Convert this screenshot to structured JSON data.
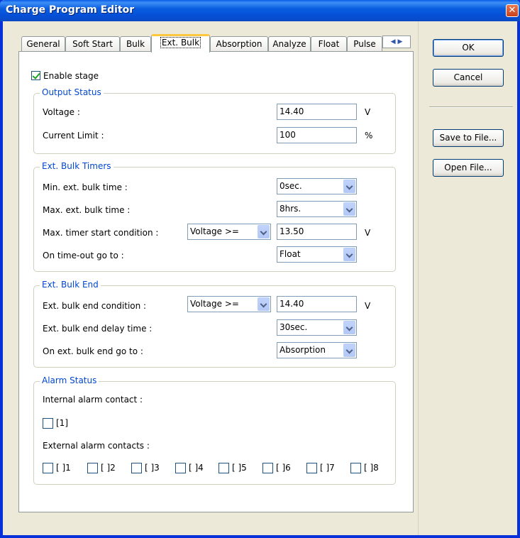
{
  "window": {
    "title": "Charge Program Editor",
    "close_icon": "close-icon"
  },
  "tabs": [
    {
      "label": "General"
    },
    {
      "label": "Soft Start"
    },
    {
      "label": "Bulk"
    },
    {
      "label": "Ext. Bulk",
      "active": true
    },
    {
      "label": "Absorption"
    },
    {
      "label": "Analyze"
    },
    {
      "label": "Float"
    },
    {
      "label": "Pulse"
    }
  ],
  "tab_scroll": {
    "left": "◀",
    "right": "▶"
  },
  "enable_stage": {
    "label": "Enable stage",
    "checked": true
  },
  "output_status": {
    "title": "Output Status",
    "voltage_label": "Voltage :",
    "voltage_value": "14.40",
    "voltage_unit": "V",
    "current_label": "Current Limit :",
    "current_value": "100",
    "current_unit": "%"
  },
  "timers": {
    "title": "Ext. Bulk Timers",
    "min_label": "Min. ext. bulk time :",
    "min_value": "0sec.",
    "max_label": "Max. ext. bulk time :",
    "max_value": "8hrs.",
    "start_label": "Max. timer start condition :",
    "start_condition": "Voltage >=",
    "start_value": "13.50",
    "start_unit": "V",
    "timeout_label": "On time-out go to :",
    "timeout_value": "Float"
  },
  "end": {
    "title": "Ext. Bulk End",
    "condition_label": "Ext. bulk end condition :",
    "condition": "Voltage >=",
    "condition_value": "14.40",
    "condition_unit": "V",
    "delay_label": "Ext. bulk end delay time :",
    "delay_value": "30sec.",
    "goto_label": "On ext. bulk end go to :",
    "goto_value": "Absorption"
  },
  "alarm": {
    "title": "Alarm Status",
    "internal_label": "Internal alarm contact :",
    "internal_item": "[1]",
    "external_label": "External alarm contacts :",
    "external_items": [
      "[ ]1",
      "[ ]2",
      "[ ]3",
      "[ ]4",
      "[ ]5",
      "[ ]6",
      "[ ]7",
      "[ ]8"
    ]
  },
  "buttons": {
    "ok": "OK",
    "cancel": "Cancel",
    "save": "Save to File...",
    "open": "Open File..."
  }
}
